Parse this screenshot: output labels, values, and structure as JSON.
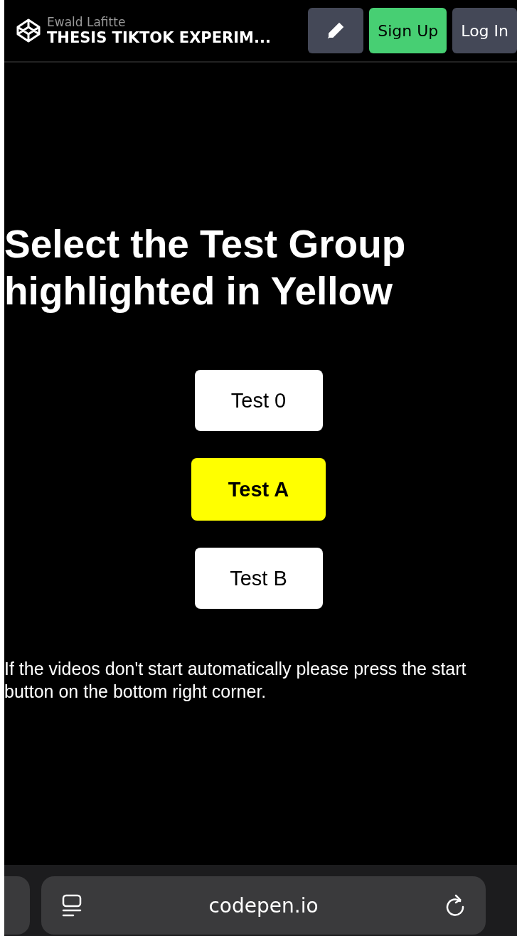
{
  "header": {
    "author": "Ewald Lafitte",
    "title": "THESIS TIKTOK EXPERIM...",
    "buttons": [
      {
        "kind": "edit"
      },
      {
        "kind": "signup",
        "label": "Sign Up"
      },
      {
        "kind": "login",
        "label": "Log In"
      }
    ]
  },
  "heading": "Select the Test Group highlighted in Yellow",
  "groups": [
    {
      "label": "Test 0",
      "selected": false
    },
    {
      "label": "Test A",
      "selected": true
    },
    {
      "label": "Test B",
      "selected": false
    }
  ],
  "note": "If the videos don't start automatically please press the start button on the bottom right corner.",
  "browser_bar": {
    "url": "codepen.io"
  }
}
